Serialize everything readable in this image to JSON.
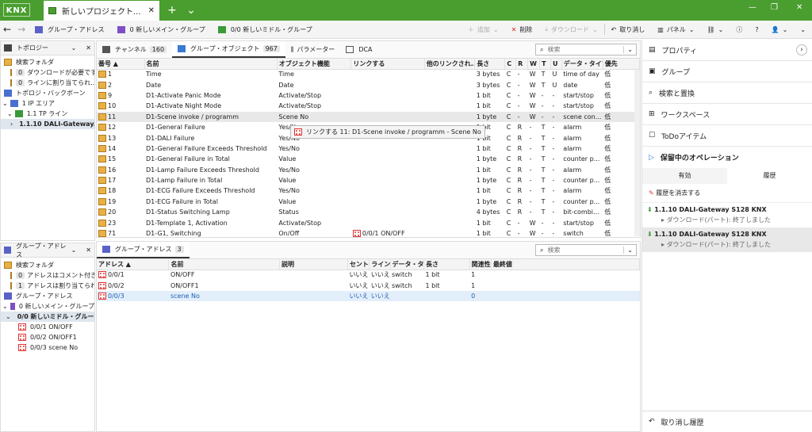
{
  "app": {
    "logo": "KNX",
    "tab_title": "新しいプロジェクト...",
    "add_tab": "+",
    "menu": "⌄",
    "win_min": "—",
    "win_max": "❐",
    "win_close": "✕"
  },
  "toolbar": {
    "back": "←",
    "fwd": "→",
    "bc1": "グループ・アドレス",
    "bc2": "0 新しいメイン・グループ",
    "bc3": "0/0 新しいミドル・グループ",
    "add": "追加",
    "delete": "削除",
    "download": "ダウンロード",
    "undo": "取り消し",
    "panel": "パネル"
  },
  "topology": {
    "title": "トポロジー",
    "items": [
      "検索フォルダ",
      "ダウンロードが必要です",
      "ラインに割り当てられ...",
      "トポロジ・バックボーン",
      "1 IP エリア",
      "1.1 TP ライン",
      "1.1.10 DALI-Gateway..."
    ],
    "counts": [
      "0",
      "0"
    ]
  },
  "ga_panel": {
    "title": "グループ・アドレス",
    "items": [
      "検索フォルダ",
      "アドレスはコメント付き...",
      "アドレスは割り当てられ...",
      "グループ・アドレス",
      "0 新しいメイン・グループ",
      "0/0 新しいミドル・グループ",
      "0/0/1 ON/OFF",
      "0/0/2 ON/OFF1",
      "0/0/3 scene No"
    ],
    "counts": [
      "0",
      "1"
    ]
  },
  "main": {
    "tabs": [
      {
        "label": "チャンネル",
        "count": "160"
      },
      {
        "label": "グループ・オブジェクト",
        "count": "967"
      },
      {
        "label": "パラメーター",
        "count": ""
      },
      {
        "label": "DCA",
        "count": ""
      }
    ],
    "search_placeholder": "検索",
    "columns": [
      "番号 ▲",
      "名前",
      "オブジェクト機能",
      "リンクする",
      "他のリンクされ...",
      "長さ",
      "C",
      "R",
      "W",
      "T",
      "U",
      "データ・タイプ",
      "優先"
    ],
    "rows": [
      [
        "1",
        "Time",
        "Time",
        "",
        "",
        "3 bytes",
        "C",
        "-",
        "W",
        "T",
        "U",
        "time of day",
        "低"
      ],
      [
        "2",
        "Date",
        "Date",
        "",
        "",
        "3 bytes",
        "C",
        "-",
        "W",
        "T",
        "U",
        "date",
        "低"
      ],
      [
        "9",
        "D1-Activate Panic Mode",
        "Activate/Stop",
        "",
        "",
        "1 bit",
        "C",
        "-",
        "W",
        "-",
        "-",
        "start/stop",
        "低"
      ],
      [
        "10",
        "D1-Activate Night Mode",
        "Activate/Stop",
        "",
        "",
        "1 bit",
        "C",
        "-",
        "W",
        "-",
        "-",
        "start/stop",
        "低"
      ],
      [
        "11",
        "D1-Scene invoke / programm",
        "Scene No",
        "",
        "",
        "1 byte",
        "C",
        "-",
        "W",
        "-",
        "-",
        "scene con...",
        "低"
      ],
      [
        "12",
        "D1-General Failure",
        "Yes/No",
        "",
        "",
        "1 bit",
        "C",
        "R",
        "-",
        "T",
        "-",
        "alarm",
        "低"
      ],
      [
        "13",
        "D1-DALI Failure",
        "Yes/No",
        "",
        "",
        "1 bit",
        "C",
        "R",
        "-",
        "T",
        "-",
        "alarm",
        "低"
      ],
      [
        "14",
        "D1-General Failure Exceeds Threshold",
        "Yes/No",
        "",
        "",
        "1 bit",
        "C",
        "R",
        "-",
        "T",
        "-",
        "alarm",
        "低"
      ],
      [
        "15",
        "D1-General Failure in Total",
        "Value",
        "",
        "",
        "1 byte",
        "C",
        "R",
        "-",
        "T",
        "-",
        "counter p...",
        "低"
      ],
      [
        "16",
        "D1-Lamp Failure Exceeds Threshold",
        "Yes/No",
        "",
        "",
        "1 bit",
        "C",
        "R",
        "-",
        "T",
        "-",
        "alarm",
        "低"
      ],
      [
        "17",
        "D1-Lamp Failure in Total",
        "Value",
        "",
        "",
        "1 byte",
        "C",
        "R",
        "-",
        "T",
        "-",
        "counter p...",
        "低"
      ],
      [
        "18",
        "D1-ECG Failure Exceeds Threshold",
        "Yes/No",
        "",
        "",
        "1 bit",
        "C",
        "R",
        "-",
        "T",
        "-",
        "alarm",
        "低"
      ],
      [
        "19",
        "D1-ECG Failure in Total",
        "Value",
        "",
        "",
        "1 byte",
        "C",
        "R",
        "-",
        "T",
        "-",
        "counter p...",
        "低"
      ],
      [
        "20",
        "D1-Status Switching Lamp",
        "Status",
        "",
        "",
        "4 bytes",
        "C",
        "R",
        "-",
        "T",
        "-",
        "bit-combi...",
        "低"
      ],
      [
        "23",
        "D1-Template 1, Activation",
        "Activate/Stop",
        "",
        "",
        "1 bit",
        "C",
        "-",
        "W",
        "-",
        "-",
        "start/stop",
        "低"
      ],
      [
        "71",
        "D1-G1, Switching",
        "On/Off",
        "0/0/1 ON/OFF",
        "",
        "1 bit",
        "C",
        "-",
        "W",
        "-",
        "-",
        "switch",
        "低"
      ]
    ],
    "tooltip": "リンクする 11: D1-Scene invoke / programm - Scene No"
  },
  "bottom": {
    "tab": "グループ・アドレス",
    "count": "3",
    "search_placeholder": "検索",
    "columns": [
      "アドレス ▲",
      "名前",
      "説明",
      "セントラ",
      "ライン・",
      "データ・タイ",
      "長さ",
      "関連性",
      "最終値"
    ],
    "rows": [
      [
        "0/0/1",
        "ON/OFF",
        "",
        "いいえ",
        "いいえ",
        "switch",
        "1 bit",
        "1",
        ""
      ],
      [
        "0/0/2",
        "ON/OFF1",
        "",
        "いいえ",
        "いいえ",
        "switch",
        "1 bit",
        "1",
        ""
      ],
      [
        "0/0/3",
        "scene No",
        "",
        "いいえ",
        "いいえ",
        "",
        "",
        "0",
        ""
      ]
    ]
  },
  "right": {
    "items": [
      "プロパティ",
      "グループ",
      "検索と置換",
      "ワークスペース",
      "ToDoアイテム"
    ],
    "pending": "保留中のオペレーション",
    "subtabs": [
      "有効",
      "履歴"
    ],
    "clear": "履歴を消去する",
    "history": [
      {
        "title": "1.1.10 DALI-Gateway S128 KNX",
        "sub": "ダウンロード(パート): 終了しました"
      },
      {
        "title": "1.1.10 DALI-Gateway S128 KNX",
        "sub": "ダウンロード(パート): 終了しました"
      }
    ],
    "undo_history": "取り消し履歴"
  }
}
